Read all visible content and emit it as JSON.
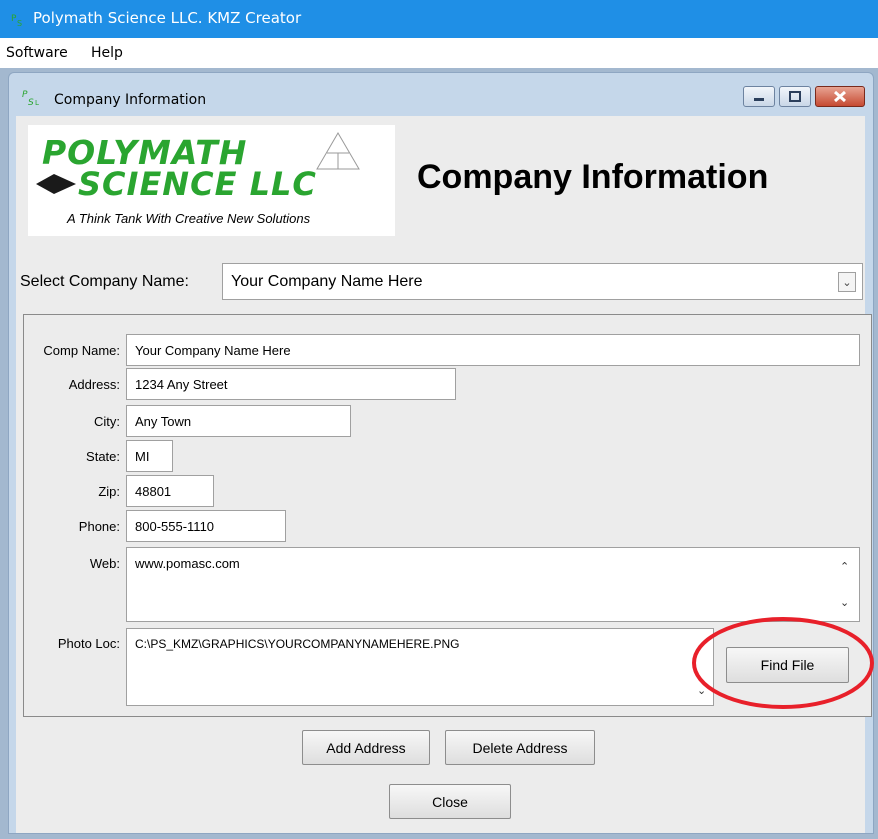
{
  "app": {
    "title": "Polymath Science LLC. KMZ Creator"
  },
  "menu": {
    "items": [
      "Software",
      "Help"
    ]
  },
  "window": {
    "title": "Company Information"
  },
  "logo": {
    "line1": "POLYMATH",
    "line2": "SCIENCE LLC",
    "tagline": "A Think Tank With Creative New Solutions"
  },
  "heading": "Company Information",
  "select_company": {
    "label": "Select Company Name:",
    "value": "Your Company Name Here"
  },
  "form": {
    "comp_name": {
      "label": "Comp Name:",
      "value": "Your Company Name Here"
    },
    "address": {
      "label": "Address:",
      "value": "1234 Any Street"
    },
    "city": {
      "label": "City:",
      "value": "Any Town"
    },
    "state": {
      "label": "State:",
      "value": "MI"
    },
    "zip": {
      "label": "Zip:",
      "value": "48801"
    },
    "phone": {
      "label": "Phone:",
      "value": "800-555-1110"
    },
    "web": {
      "label": "Web:",
      "value": "www.pomasc.com"
    },
    "photo_loc": {
      "label": "Photo Loc:",
      "value": "C:\\PS_KMZ\\GRAPHICS\\YOURCOMPANYNAMEHERE.PNG"
    }
  },
  "buttons": {
    "find_file": "Find File",
    "add_address": "Add Address",
    "delete_address": "Delete Address",
    "close": "Close"
  },
  "colors": {
    "titlebar": "#1f8fe6",
    "logo_green": "#2aa530",
    "highlight_ring": "#e8202a"
  },
  "icons": {
    "app": "psl-logo-icon",
    "minimize": "minimize-icon",
    "maximize": "maximize-icon",
    "close": "close-icon",
    "dropdown": "chevron-down-icon"
  }
}
